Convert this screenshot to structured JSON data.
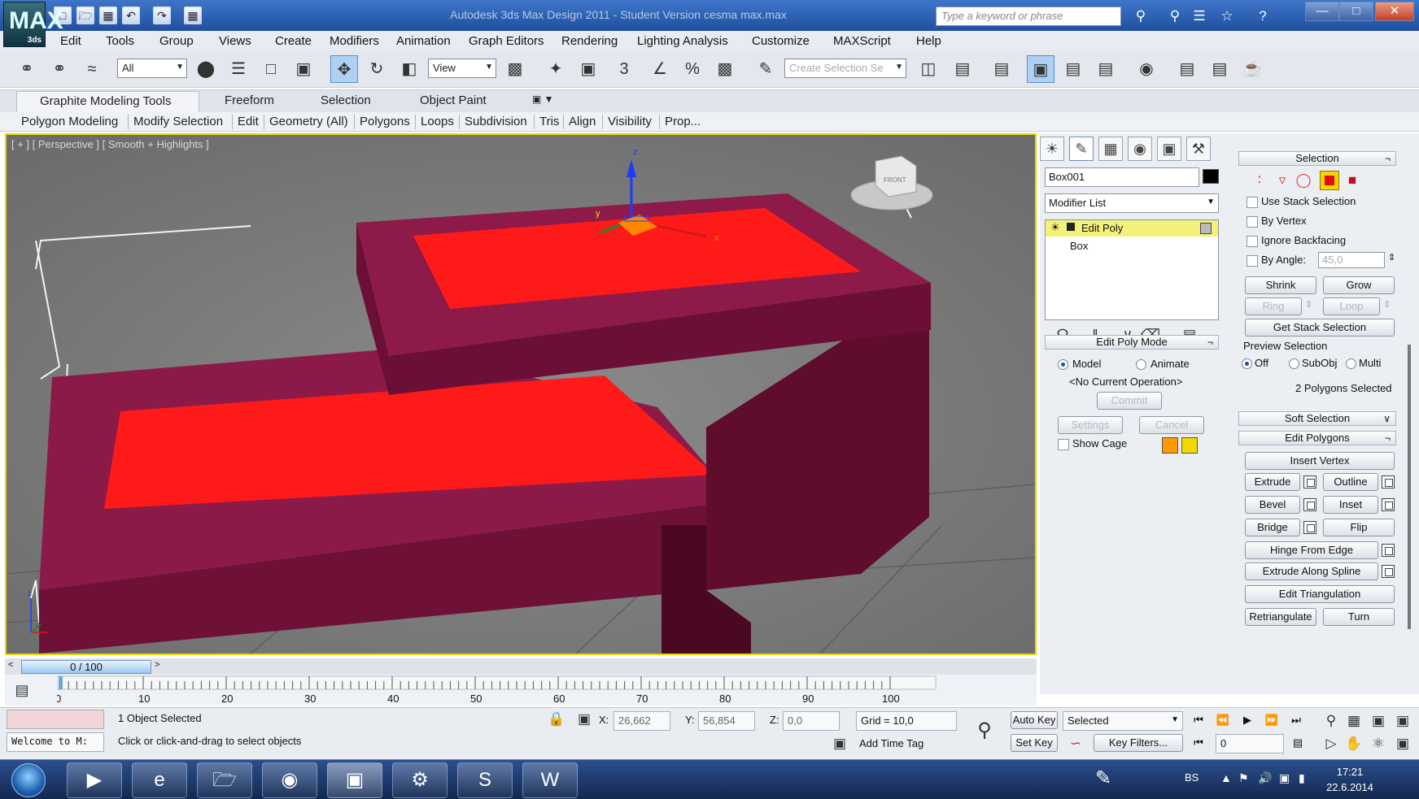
{
  "window": {
    "title": "Autodesk 3ds Max Design 2011 - Student Version   cesma max.max",
    "app_logo": "MAX",
    "app_logo_version": "3ds",
    "search_placeholder": "Type a keyword or phrase"
  },
  "menu": [
    "Edit",
    "Tools",
    "Group",
    "Views",
    "Create",
    "Modifiers",
    "Animation",
    "Graph Editors",
    "Rendering",
    "Lighting Analysis",
    "Customize",
    "MAXScript",
    "Help"
  ],
  "toolbar": {
    "selection_filter": "All",
    "ref_coord": "View",
    "named_selection_placeholder": "Create Selection Se",
    "snap_3": "3",
    "angle_snap_glyph": "∠",
    "percent_snap": "%"
  },
  "ribbon": {
    "tabs": [
      "Graphite Modeling Tools",
      "Freeform",
      "Selection",
      "Object Paint"
    ],
    "panels": [
      "Polygon Modeling",
      "Modify Selection",
      "Edit",
      "Geometry (All)",
      "Polygons",
      "Loops",
      "Subdivision",
      "Tris",
      "Align",
      "Visibility",
      "Prop..."
    ]
  },
  "viewport": {
    "label": "[ + ] [ Perspective ] [ Smooth + Highlights ]",
    "gizmo_z": "z",
    "gizmo_y": "y",
    "gizmo_x": "x",
    "viewcube_face": "FRONT",
    "axis_z": "z"
  },
  "command_panel": {
    "object_name": "Box001",
    "modifier_list": "Modifier List",
    "stack": [
      "Edit Poly",
      "Box"
    ],
    "edit_poly_mode": {
      "title": "Edit Poly Mode",
      "model": "Model",
      "animate": "Animate",
      "current_op": "<No Current Operation>",
      "commit": "Commit",
      "settings": "Settings",
      "cancel": "Cancel",
      "show_cage": "Show Cage",
      "cage_color_1": "#ff9900",
      "cage_color_2": "#f0d800"
    },
    "selection": {
      "title": "Selection",
      "use_stack": "Use Stack Selection",
      "by_vertex": "By Vertex",
      "ignore_backfacing": "Ignore Backfacing",
      "by_angle": "By Angle:",
      "by_angle_value": "45,0",
      "shrink": "Shrink",
      "grow": "Grow",
      "ring": "Ring",
      "loop": "Loop",
      "get_stack": "Get Stack Selection",
      "preview_title": "Preview Selection",
      "preview_off": "Off",
      "preview_subobj": "SubObj",
      "preview_multi": "Multi",
      "status": "2 Polygons Selected"
    },
    "soft_selection": {
      "title": "Soft Selection"
    },
    "edit_polygons": {
      "title": "Edit Polygons",
      "insert_vertex": "Insert Vertex",
      "extrude": "Extrude",
      "outline": "Outline",
      "bevel": "Bevel",
      "inset": "Inset",
      "bridge": "Bridge",
      "flip": "Flip",
      "hinge": "Hinge From Edge",
      "extrude_spline": "Extrude Along Spline",
      "edit_triangulation": "Edit Triangulation",
      "retriangulate": "Retriangulate",
      "turn": "Turn"
    },
    "pin": "¬"
  },
  "timeline": {
    "frame": "0 / 100",
    "ticks": [
      "0",
      "10",
      "20",
      "30",
      "40",
      "50",
      "60",
      "70",
      "80",
      "90",
      "100"
    ],
    "tick_values": [
      0,
      10,
      20,
      30,
      40,
      50,
      60,
      70,
      80,
      90,
      100
    ],
    "prev": "<",
    "next": ">"
  },
  "status": {
    "maxscript_mini": "",
    "listener": "Welcome to M:",
    "objects_selected": "1 Object Selected",
    "prompt": "Click or click-and-drag to select objects",
    "x_label": "X:",
    "x_value": "26,662",
    "y_label": "Y:",
    "y_value": "56,854",
    "z_label": "Z:",
    "z_value": "0,0",
    "grid": "Grid = 10,0",
    "add_time_tag": "Add Time Tag",
    "auto_key": "Auto Key",
    "set_key": "Set Key",
    "key_mode": "Selected",
    "key_filters": "Key Filters...",
    "current_frame": "0"
  },
  "taskbar": {
    "lang": "BS",
    "time": "17:21",
    "date": "22.6.2014"
  },
  "colors": {
    "selected_poly": "#ff1a1a",
    "box_body": "#8e1a4a",
    "viewport_bg": "#7a7a7a",
    "active_border": "#e6d800"
  }
}
